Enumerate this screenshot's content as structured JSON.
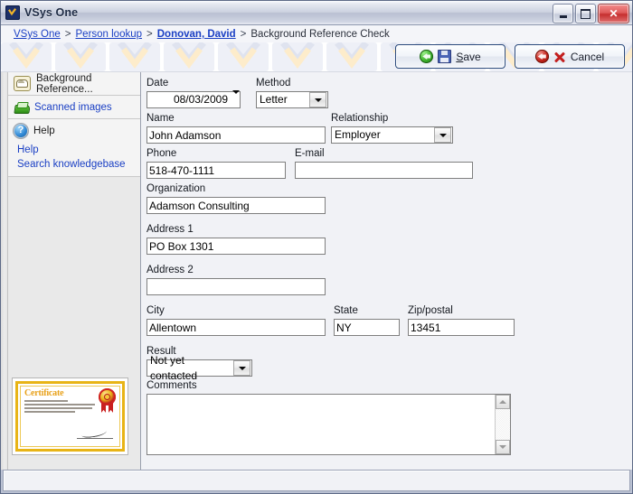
{
  "window": {
    "title": "VSys One",
    "app_icon": "vsys-shield-check-icon",
    "minimize_label": "Minimize",
    "maximize_label": "Maximize",
    "close_label": "Close"
  },
  "breadcrumb": {
    "items": [
      {
        "label": "VSys One",
        "type": "link"
      },
      {
        "label": "Person lookup",
        "type": "link"
      },
      {
        "label": "Donovan, David",
        "type": "link-bold"
      },
      {
        "label": "Background Reference Check",
        "type": "current"
      }
    ],
    "separator": ">"
  },
  "toolbar": {
    "save_label": "Save",
    "save_accesskey": "S",
    "save_icon": "green-back-arrow-icon",
    "save_icon_2": "floppy-disk-icon",
    "cancel_label": "Cancel",
    "cancel_icon": "red-back-arrow-icon",
    "cancel_icon_2": "red-x-icon"
  },
  "sidebar": {
    "sections": [
      {
        "label": "Background Reference...",
        "icon": "background-check-icon",
        "style": "dark"
      },
      {
        "label": "Scanned images",
        "icon": "scanner-icon",
        "style": "link"
      },
      {
        "label": "Help",
        "icon": "help-question-icon",
        "style": "dark",
        "links": [
          "Help",
          "Search knowledgebase"
        ]
      }
    ],
    "certificate": {
      "title": "Certificate",
      "seal_icon": "award-seal-icon",
      "signature_icon": "signature-icon"
    }
  },
  "form": {
    "date": {
      "label": "Date",
      "value": "08/03/2009"
    },
    "method": {
      "label": "Method",
      "value": "Letter"
    },
    "name": {
      "label": "Name",
      "value": "John Adamson"
    },
    "relationship": {
      "label": "Relationship",
      "value": "Employer"
    },
    "phone": {
      "label": "Phone",
      "value": "518-470-1111"
    },
    "email": {
      "label": "E-mail",
      "value": "",
      "focused": true
    },
    "organization": {
      "label": "Organization",
      "value": "Adamson Consulting"
    },
    "address1": {
      "label": "Address 1",
      "value": "PO Box 1301"
    },
    "address2": {
      "label": "Address 2",
      "value": ""
    },
    "city": {
      "label": "City",
      "value": "Allentown"
    },
    "state": {
      "label": "State",
      "value": "NY"
    },
    "zip": {
      "label": "Zip/postal",
      "value": "13451"
    },
    "result": {
      "label": "Result",
      "value": "Not yet contacted"
    },
    "comments": {
      "label": "Comments",
      "value": ""
    }
  },
  "statusbar": {
    "text": ""
  },
  "colors": {
    "link": "#1a3fc4",
    "titlebar": "#ccd2e0",
    "pane": "#f1f2f6",
    "sidebar": "#e9e9e9",
    "accent_green": "#3fb32d",
    "accent_red": "#c4241c",
    "certificate_gold": "#e8b416"
  }
}
